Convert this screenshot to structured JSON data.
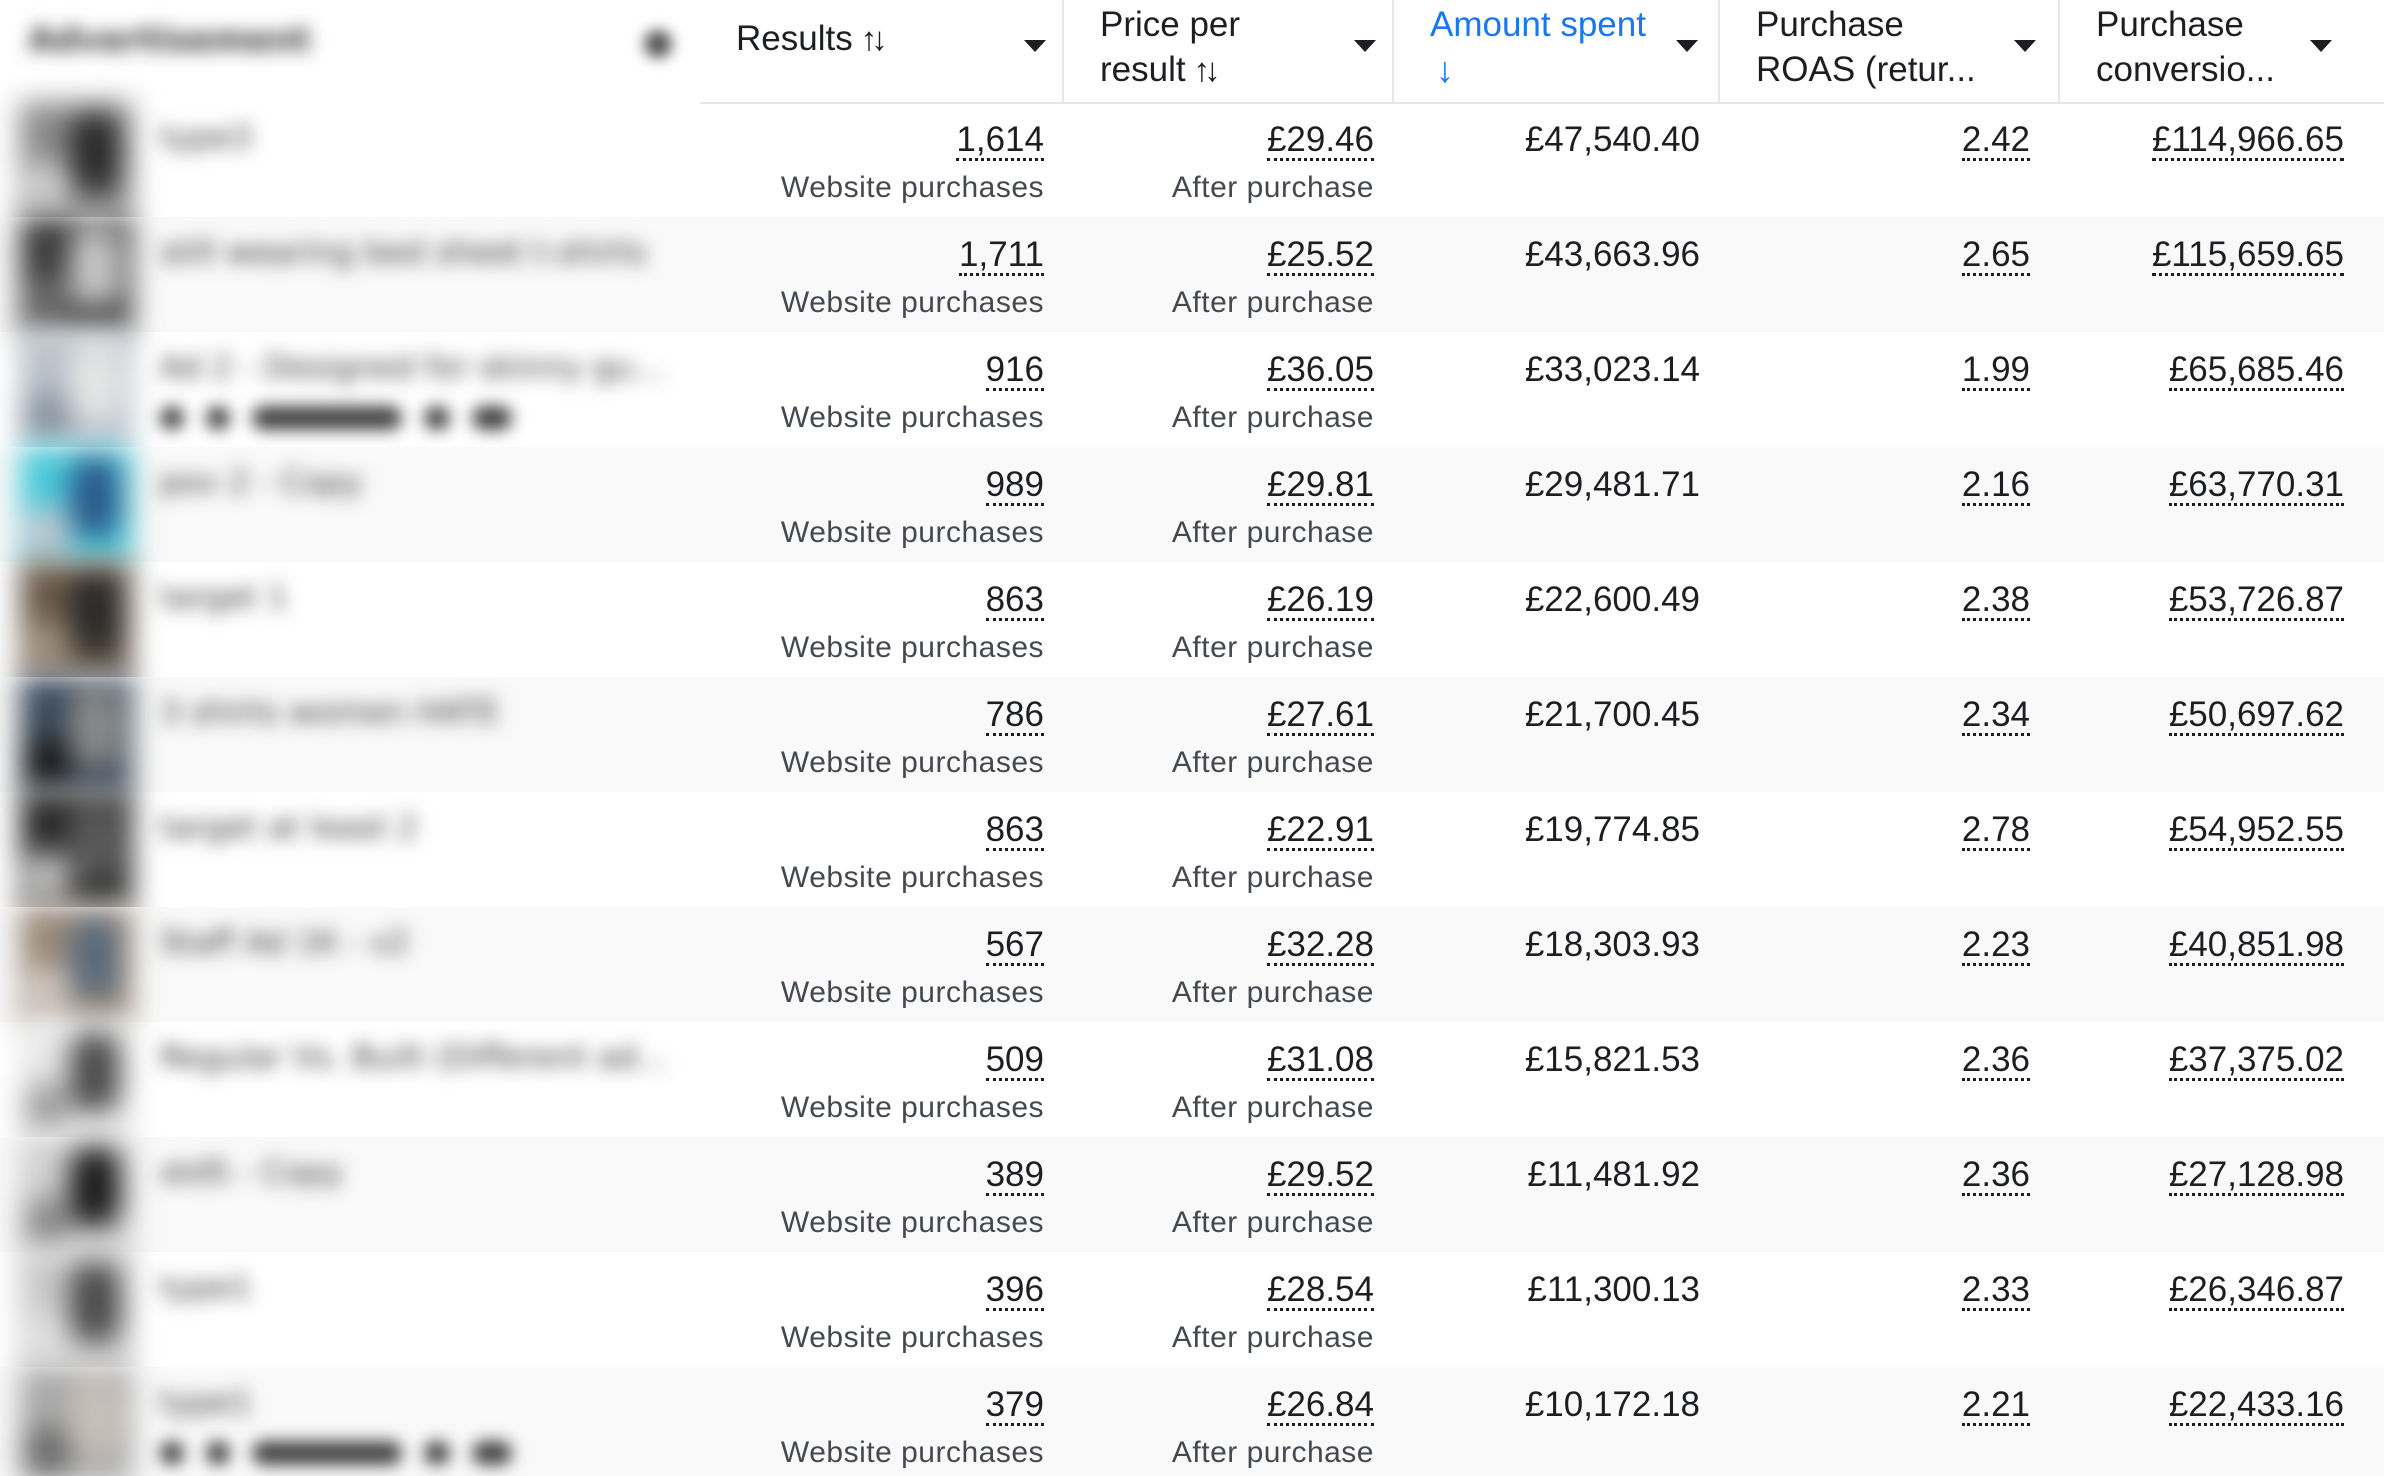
{
  "ad_column": {
    "header": "Advertisement",
    "rows": [
      {
        "name": "type3",
        "show_actions": false
      },
      {
        "name": "still wearing bed sheet t-shirts",
        "show_actions": false
      },
      {
        "name": "Ad 2 - Designed for skinny gu...",
        "show_actions": true
      },
      {
        "name": "pov 2 - Copy",
        "show_actions": false
      },
      {
        "name": "target 1",
        "show_actions": false
      },
      {
        "name": "3 shirts women HATE",
        "show_actions": false
      },
      {
        "name": "target at least 2",
        "show_actions": false
      },
      {
        "name": "Staff Ad 1K - v2",
        "show_actions": false
      },
      {
        "name": "Regular Vs. Built (Different ad...",
        "show_actions": false
      },
      {
        "name": "std5 - Copy",
        "show_actions": false
      },
      {
        "name": "type1",
        "show_actions": false
      },
      {
        "name": "type1",
        "show_actions": true
      }
    ]
  },
  "columns": [
    {
      "key": "results",
      "label": "Results",
      "sort_icon": "sort-updown-icon",
      "active": false
    },
    {
      "key": "price",
      "label": "Price per\nresult",
      "sort_icon": "sort-updown-icon",
      "active": false
    },
    {
      "key": "spent",
      "label": "Amount spent",
      "sort_icon": "sort-down-icon",
      "active": true
    },
    {
      "key": "roas",
      "label": "Purchase\nROAS (retur...",
      "sort_icon": "",
      "active": false
    },
    {
      "key": "conv",
      "label": "Purchase\nconversio...",
      "sort_icon": "",
      "active": false
    }
  ],
  "rows": [
    {
      "results": "1,614",
      "results_sub": "Website purchases",
      "price": "£29.46",
      "price_sub": "After purchase",
      "spent": "£47,540.40",
      "roas": "2.42",
      "conv": "£114,966.65"
    },
    {
      "results": "1,711",
      "results_sub": "Website purchases",
      "price": "£25.52",
      "price_sub": "After purchase",
      "spent": "£43,663.96",
      "roas": "2.65",
      "conv": "£115,659.65"
    },
    {
      "results": "916",
      "results_sub": "Website purchases",
      "price": "£36.05",
      "price_sub": "After purchase",
      "spent": "£33,023.14",
      "roas": "1.99",
      "conv": "£65,685.46"
    },
    {
      "results": "989",
      "results_sub": "Website purchases",
      "price": "£29.81",
      "price_sub": "After purchase",
      "spent": "£29,481.71",
      "roas": "2.16",
      "conv": "£63,770.31"
    },
    {
      "results": "863",
      "results_sub": "Website purchases",
      "price": "£26.19",
      "price_sub": "After purchase",
      "spent": "£22,600.49",
      "roas": "2.38",
      "conv": "£53,726.87"
    },
    {
      "results": "786",
      "results_sub": "Website purchases",
      "price": "£27.61",
      "price_sub": "After purchase",
      "spent": "£21,700.45",
      "roas": "2.34",
      "conv": "£50,697.62"
    },
    {
      "results": "863",
      "results_sub": "Website purchases",
      "price": "£22.91",
      "price_sub": "After purchase",
      "spent": "£19,774.85",
      "roas": "2.78",
      "conv": "£54,952.55"
    },
    {
      "results": "567",
      "results_sub": "Website purchases",
      "price": "£32.28",
      "price_sub": "After purchase",
      "spent": "£18,303.93",
      "roas": "2.23",
      "conv": "£40,851.98"
    },
    {
      "results": "509",
      "results_sub": "Website purchases",
      "price": "£31.08",
      "price_sub": "After purchase",
      "spent": "£15,821.53",
      "roas": "2.36",
      "conv": "£37,375.02"
    },
    {
      "results": "389",
      "results_sub": "Website purchases",
      "price": "£29.52",
      "price_sub": "After purchase",
      "spent": "£11,481.92",
      "roas": "2.36",
      "conv": "£27,128.98"
    },
    {
      "results": "396",
      "results_sub": "Website purchases",
      "price": "£28.54",
      "price_sub": "After purchase",
      "spent": "£11,300.13",
      "roas": "2.33",
      "conv": "£26,346.87"
    },
    {
      "results": "379",
      "results_sub": "Website purchases",
      "price": "£26.84",
      "price_sub": "After purchase",
      "spent": "£10,172.18",
      "roas": "2.21",
      "conv": "£22,433.16"
    }
  ],
  "colors": {
    "accent": "#1877f2",
    "text": "#1c1e21",
    "subtext": "#444950",
    "divider": "#e4e6eb",
    "row_alt": "#f9f9f9"
  }
}
